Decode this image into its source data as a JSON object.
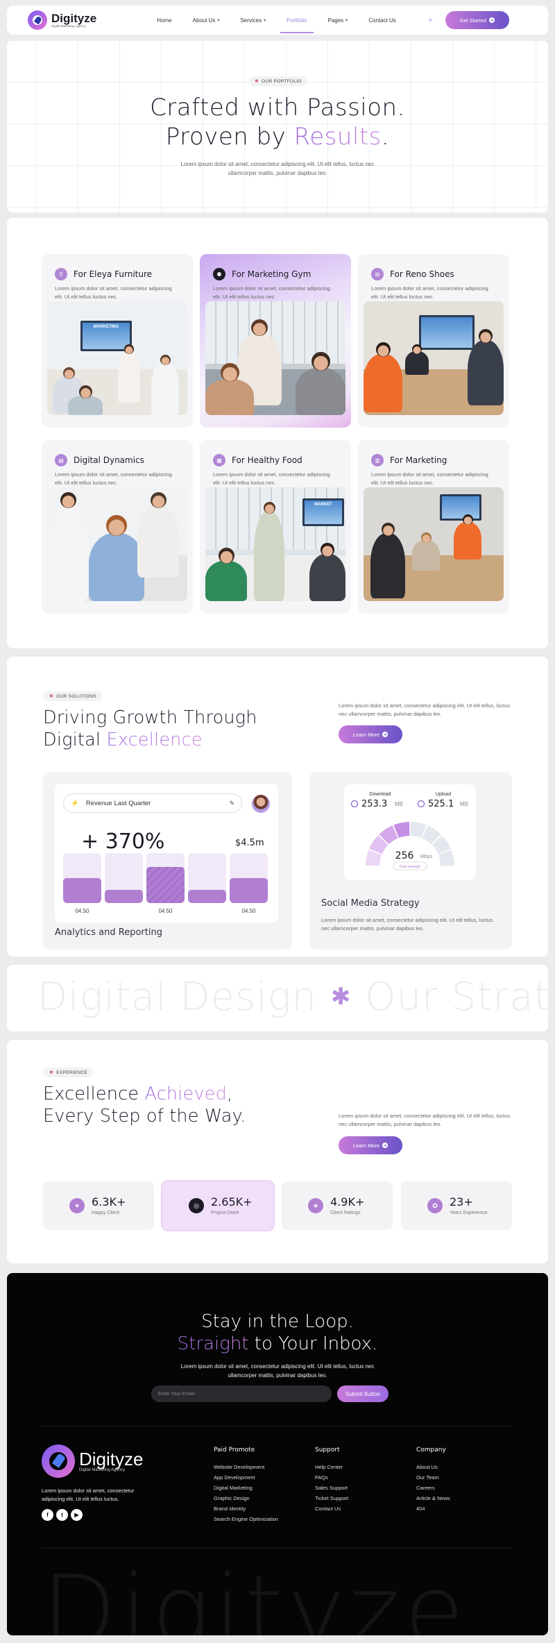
{
  "nav": {
    "brand": "Digityze",
    "brand_tag": "Digital Marketing Agency",
    "items": [
      {
        "label": "Home",
        "caret": false,
        "active": false
      },
      {
        "label": "About Us",
        "caret": true,
        "active": false
      },
      {
        "label": "Services",
        "caret": true,
        "active": false
      },
      {
        "label": "Portfolio",
        "caret": false,
        "active": true
      },
      {
        "label": "Pages",
        "caret": true,
        "active": false
      },
      {
        "label": "Contact Us",
        "caret": false,
        "active": false
      }
    ],
    "cta": "Get Started"
  },
  "hero": {
    "tag": "OUR PORTFOLIO",
    "title_line1": "Crafted with Passion.",
    "title_line2_prefix": "Proven by ",
    "title_line2_accent": "Results",
    "title_line2_suffix": ".",
    "subtitle": "Lorem ipsum dolor sit amet, consectetur adipiscing elit. Ut elit tellus, luctus nec ullamcorper mattis, pulvinar dapibus leo."
  },
  "portfolio": {
    "cards": [
      {
        "title": "For Eleya Furniture",
        "desc": "Lorem ipsum dolor sit amet, consectetur adipiscing elit. Ut elit tellus luctus nec.",
        "icon": "chair-icon",
        "icon_glyph": "⚲",
        "highlighted": false
      },
      {
        "title": "For Marketing Gym",
        "desc": "Lorem ipsum dolor sit amet, consectetur adipiscing elit. Ut elit tellus luctus nec.",
        "icon": "dumbbell-icon",
        "icon_glyph": "⚉",
        "highlighted": true
      },
      {
        "title": "For Reno Shoes",
        "desc": "Lorem ipsum dolor sit amet, consectetur adipiscing elit. Ut elit tellus luctus nec.",
        "icon": "shoe-icon",
        "icon_glyph": "⊞",
        "highlighted": false
      },
      {
        "title": "Digital Dynamics",
        "desc": "Lorem ipsum dolor sit amet, consectetur adipiscing elit. Ut elit tellus luctus nec.",
        "icon": "chart-icon",
        "icon_glyph": "▤",
        "highlighted": false
      },
      {
        "title": "For Healthy Food",
        "desc": "Lorem ipsum dolor sit amet, consectetur adipiscing elit. Ut elit tellus luctus nec.",
        "icon": "food-icon",
        "icon_glyph": "▦",
        "highlighted": false
      },
      {
        "title": "For Marketing",
        "desc": "Lorem ipsum dolor sit amet, consectetur adipiscing elit. Ut elit tellus luctus nec.",
        "icon": "graph-icon",
        "icon_glyph": "▥",
        "highlighted": false
      }
    ],
    "screen_text_1": "MARKETING",
    "screen_text_2": "MARKET"
  },
  "solutions": {
    "tag": "OUR SOLUTIONS",
    "title_line1": "Driving Growth Through",
    "title_line2_prefix": "Digital ",
    "title_line2_accent": "Excellence",
    "side_text": "Lorem ipsum dolor sit amet, consectetur adipiscing elit. Ut elit tellus, luctus nec ullamcorper mattis, pulvinar dapibus leo.",
    "learn_more": "Learn More",
    "analytics": {
      "search_label": "Revenue Last Quarter",
      "percent": "+ 370%",
      "amount": "$4.5m",
      "bars": [
        {
          "fill": 0.5,
          "hatch": false,
          "label": "04.50"
        },
        {
          "fill": 0.27,
          "hatch": false,
          "label": ""
        },
        {
          "fill": 0.72,
          "hatch": true,
          "label": "04.50"
        },
        {
          "fill": 0.27,
          "hatch": false,
          "label": ""
        },
        {
          "fill": 0.5,
          "hatch": false,
          "label": "04.50"
        }
      ],
      "title": "Analytics and Reporting"
    },
    "social": {
      "download_label": "Download",
      "download_value": "253.3",
      "download_unit": "MB",
      "upload_label": "Upload",
      "upload_value": "525.1",
      "upload_unit": "MB",
      "speed_value": "256",
      "speed_unit": "Mbps",
      "speed_status": "Fast enough",
      "gauge_level": 0.6,
      "title": "Social Media Strategy",
      "desc": "Lorem ipsum dolor sit amet, consectetur adipiscing elit. Ut elit tellus, luctus nec ullamcorper mattis, pulvinar dapibus leo."
    }
  },
  "marquee": {
    "text1": "Digital Design",
    "text2": "Our Strategy"
  },
  "experience": {
    "tag": "EXPERIENCE",
    "title_line1_prefix": "Excellence ",
    "title_line1_accent": "Achieved",
    "title_line1_suffix": ",",
    "title_line2": "Every Step of the Way.",
    "side_text": "Lorem ipsum dolor sit amet, consectetur adipiscing elit. Ut elit tellus, luctus nec ullamcorper mattis, pulvinar dapibus leo.",
    "learn_more": "Learn More",
    "stats": [
      {
        "value": "6.3K+",
        "label": "Happy Client",
        "icon": "heart-icon",
        "icon_glyph": "♥",
        "highlighted": false
      },
      {
        "value": "2.65K+",
        "label": "Project Done",
        "icon": "target-icon",
        "icon_glyph": "◎",
        "highlighted": true
      },
      {
        "value": "4.9K+",
        "label": "Client Ratings",
        "icon": "star-icon",
        "icon_glyph": "★",
        "highlighted": false
      },
      {
        "value": "23+",
        "label": "Years Experience",
        "icon": "medal-icon",
        "icon_glyph": "✪",
        "highlighted": false
      }
    ]
  },
  "footer": {
    "newsletter_line1": "Stay in the Loop.",
    "newsletter_line2_accent": "Straight",
    "newsletter_line2_suffix": " to Your Inbox.",
    "newsletter_sub": "Lorem ipsum dolor sit amet, consectetur adipiscing elit. Ut elit tellus, luctus nec ullamcorper mattis, pulvinar dapibus leo.",
    "email_placeholder": "Enter Your Email",
    "submit": "Submit Button",
    "brand": "Digityze",
    "brand_tag": "Digital Marketing Agency",
    "brand_desc": "Lorem ipsum dolor sit amet, consectetur adipiscing elit. Ut elit tellus luctus.",
    "socials": [
      {
        "name": "facebook-icon",
        "glyph": "f"
      },
      {
        "name": "twitter-icon",
        "glyph": "t"
      },
      {
        "name": "youtube-icon",
        "glyph": "▶"
      }
    ],
    "columns": [
      {
        "title": "Paid Promote",
        "links": [
          "Website Development",
          "App Development",
          "Digital Marketing",
          "Graphic Design",
          "Brand Identity",
          "Search Engine Optimization"
        ]
      },
      {
        "title": "Support",
        "links": [
          "Help Center",
          "FAQs",
          "Sales Support",
          "Ticket Support",
          "Contact Us"
        ]
      },
      {
        "title": "Company",
        "links": [
          "About Us",
          "Our Team",
          "Careers",
          "Article & News",
          "404"
        ]
      }
    ],
    "watermark": "Digityze"
  },
  "colors": {
    "accent_purple": "#b07fd2",
    "cta_gradient_start": "#c77ad9",
    "cta_gradient_end": "#6953c8",
    "footer_bg": "#050506"
  }
}
